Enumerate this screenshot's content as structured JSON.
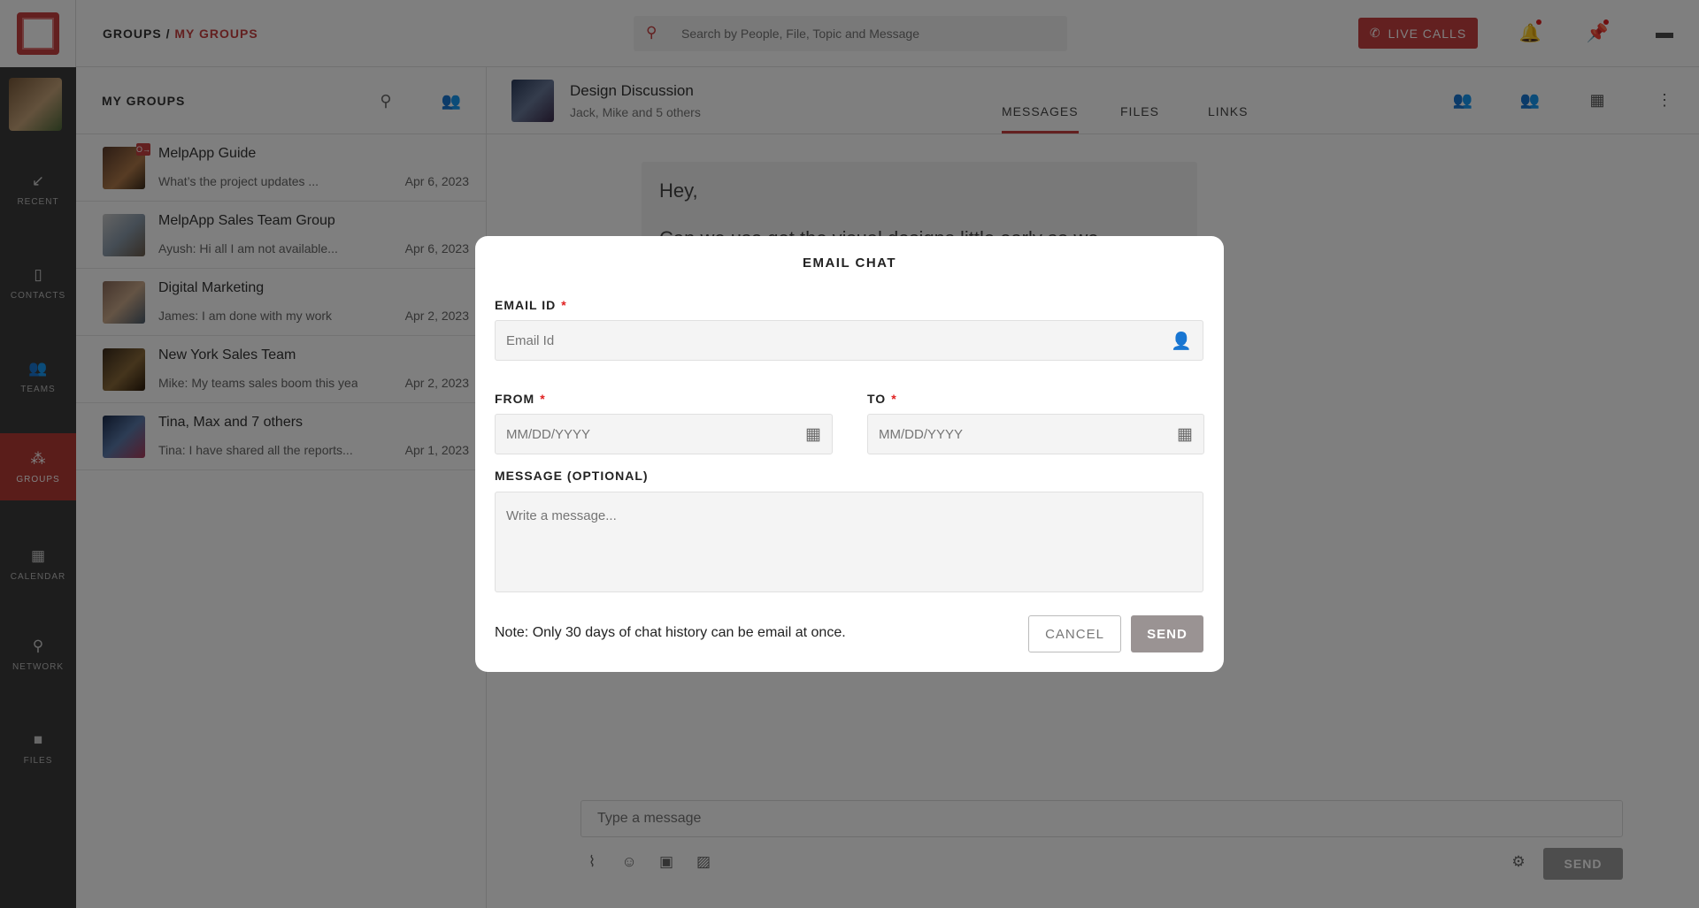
{
  "header": {
    "breadcrumb_root": "GROUPS",
    "breadcrumb_sep": " / ",
    "breadcrumb_current": "MY GROUPS",
    "search_placeholder": "Search by People, File, Topic and Message",
    "live_calls_label": "LIVE CALLS"
  },
  "sidebar": {
    "items": [
      {
        "label": "RECENT",
        "icon": "arrow-icon"
      },
      {
        "label": "CONTACTS",
        "icon": "contacts-icon"
      },
      {
        "label": "TEAMS",
        "icon": "teams-icon"
      },
      {
        "label": "GROUPS",
        "icon": "groups-icon",
        "active": true
      },
      {
        "label": "CALENDAR",
        "icon": "calendar-icon"
      },
      {
        "label": "NETWORK",
        "icon": "network-icon"
      },
      {
        "label": "FILES",
        "icon": "folder-icon"
      }
    ]
  },
  "groups_panel": {
    "title": "MY GROUPS",
    "groups": [
      {
        "name": "MelpApp Guide",
        "preview": "What’s the project updates ...",
        "date": "Apr 6, 2023",
        "badge": "O→"
      },
      {
        "name": "MelpApp Sales Team Group",
        "preview": "Ayush: Hi all I am not available...",
        "date": "Apr 6, 2023"
      },
      {
        "name": "Digital Marketing",
        "preview": "James: I am done with my work",
        "date": "Apr 2, 2023"
      },
      {
        "name": "New York Sales Team",
        "preview": "Mike: My teams sales boom this year.",
        "date": "Apr 2, 2023"
      },
      {
        "name": "Tina, Max and 7 others",
        "preview": "Tina: I have shared all the reports...",
        "date": "Apr 1, 2023"
      }
    ]
  },
  "chat": {
    "title": "Design Discussion",
    "subtitle": "Jack, Mike and 5 others",
    "tabs": [
      "MESSAGES",
      "FILES",
      "LINKS"
    ],
    "active_tab": "MESSAGES",
    "message_line_1": "Hey,",
    "message_line_2": "Can we use get the visual designs little early so we",
    "composer_placeholder": "Type a message",
    "send_label": "SEND"
  },
  "modal": {
    "title": "EMAIL CHAT",
    "email_label": "EMAIL ID",
    "email_placeholder": "Email Id",
    "from_label": "FROM",
    "from_placeholder": "MM/DD/YYYY",
    "to_label": "TO",
    "to_placeholder": "MM/DD/YYYY",
    "message_label": "MESSAGE (OPTIONAL)",
    "message_placeholder": "Write a message...",
    "note": "Note: Only 30 days of chat history can be email at once.",
    "cancel_label": "CANCEL",
    "send_label": "SEND",
    "required_mark": "*"
  },
  "colors": {
    "accent": "#c64040",
    "rail": "#3a3a3a",
    "send_disabled": "#9a9393"
  }
}
